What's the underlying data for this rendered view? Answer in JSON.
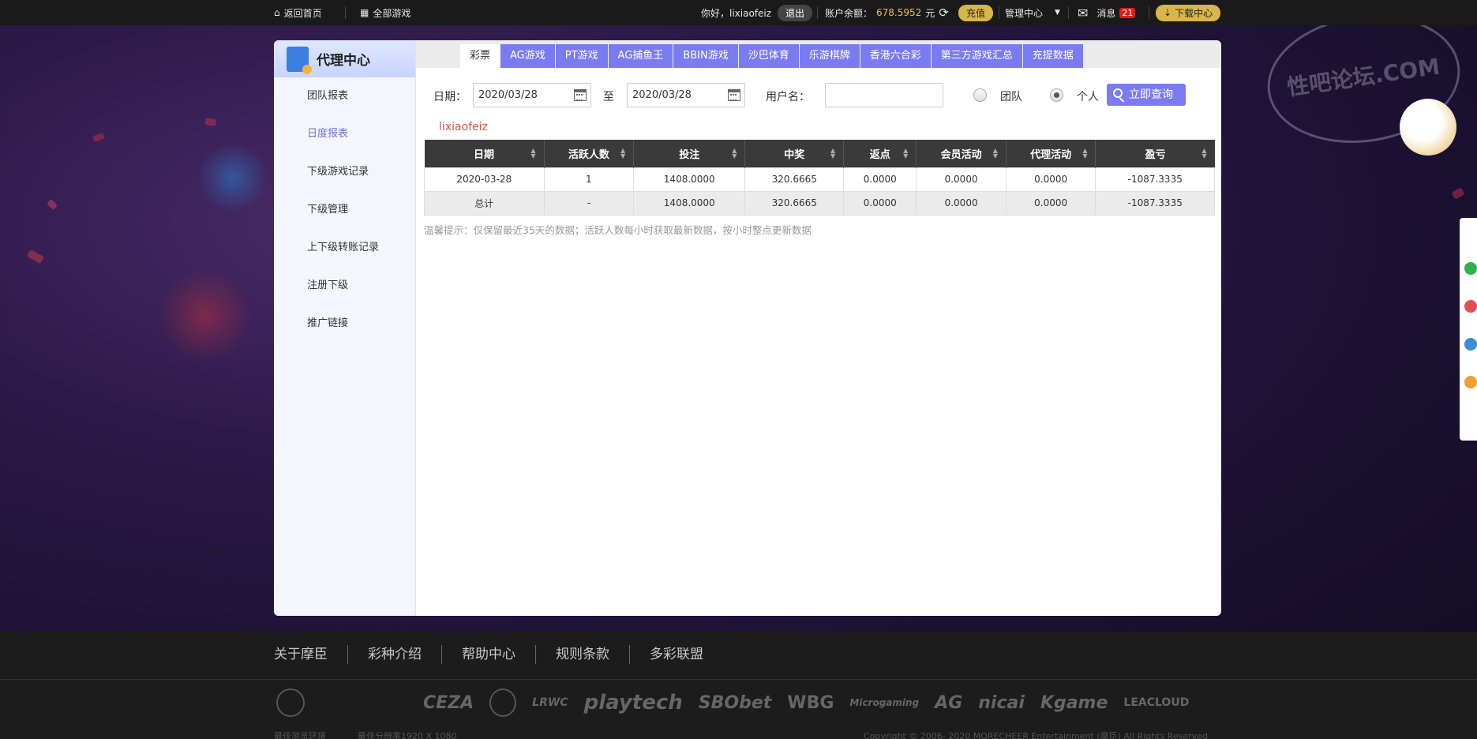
{
  "topbar": {
    "home": "返回首页",
    "all_games": "全部游戏",
    "greeting": "你好，lixiaofeiz",
    "logout": "退出",
    "balance_label": "账户余额：",
    "balance_value": "678.5952",
    "balance_unit": "元",
    "recharge": "充值",
    "admin_center": "管理中心",
    "messages": "消息",
    "message_count": "21",
    "download": "下载中心"
  },
  "sidebar": {
    "title": "代理中心",
    "items": [
      {
        "label": "团队报表"
      },
      {
        "label": "日度报表"
      },
      {
        "label": "下级游戏记录"
      },
      {
        "label": "下级管理"
      },
      {
        "label": "上下级转账记录"
      },
      {
        "label": "注册下级"
      },
      {
        "label": "推广链接"
      }
    ]
  },
  "tabs": [
    {
      "label": "彩票"
    },
    {
      "label": "AG游戏"
    },
    {
      "label": "PT游戏"
    },
    {
      "label": "AG捕鱼王"
    },
    {
      "label": "BBIN游戏"
    },
    {
      "label": "沙巴体育"
    },
    {
      "label": "乐游棋牌"
    },
    {
      "label": "香港六合彩"
    },
    {
      "label": "第三方游戏汇总"
    },
    {
      "label": "充提数据"
    }
  ],
  "filter": {
    "date_label": "日期：",
    "start_date": "2020/03/28",
    "to_label": "至",
    "end_date": "2020/03/28",
    "username_label": "用户名：",
    "username_value": "",
    "team_label": "团队",
    "personal_label": "个人",
    "query_button": "立即查询"
  },
  "current_user": "lixiaofeiz",
  "table": {
    "headers": [
      "日期",
      "活跃人数",
      "投注",
      "中奖",
      "返点",
      "会员活动",
      "代理活动",
      "盈亏"
    ],
    "rows": [
      [
        "2020-03-28",
        "1",
        "1408.0000",
        "320.6665",
        "0.0000",
        "0.0000",
        "0.0000",
        "-1087.3335"
      ]
    ],
    "total": [
      "总计",
      "-",
      "1408.0000",
      "320.6665",
      "0.0000",
      "0.0000",
      "0.0000",
      "-1087.3335"
    ]
  },
  "tip": "温馨提示：仅保留最近35天的数据；活跃人数每小时获取最新数据，按小时整点更新数据",
  "footer": {
    "links": [
      "关于摩臣",
      "彩种介绍",
      "帮助中心",
      "规则条款",
      "多彩联盟"
    ],
    "brands": [
      "CEZA",
      "LRWC",
      "playtech",
      "SBObet",
      "WBG",
      "Microgaming",
      "AG",
      "nicai",
      "Kgame",
      "LEACLOUD"
    ],
    "left_text": "最佳游览环境",
    "resolution_text": "最佳分辨率1920 X 1080",
    "copyright": "Copyright © 2006- 2020 MORECHEER Entertainment (摩臣) All Rights Reserved"
  },
  "watermark": "性吧论坛.COM",
  "colors": {
    "accent": "#7a7bf1",
    "sidebar_active": "#6f6fd8",
    "username": "#e0504a",
    "balance": "#f0c040"
  }
}
